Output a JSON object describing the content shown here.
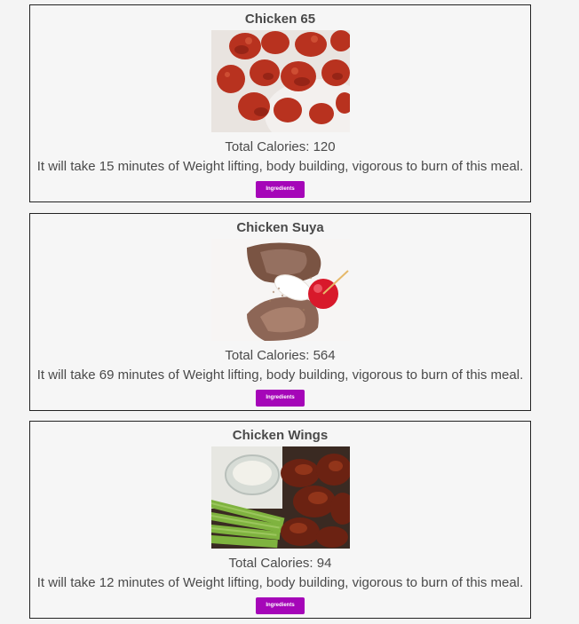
{
  "meals": [
    {
      "title": "Chicken 65",
      "calories_text": "Total Calories: 120",
      "burn_text": "It will take 15 minutes of Weight lifting, body building, vigorous to burn of this meal.",
      "button_label": "Ingredients",
      "image": "chicken-65-photo"
    },
    {
      "title": "Chicken Suya",
      "calories_text": "Total Calories: 564",
      "burn_text": "It will take 69 minutes of Weight lifting, body building, vigorous to burn of this meal.",
      "button_label": "Ingredients",
      "image": "chicken-suya-photo"
    },
    {
      "title": "Chicken Wings",
      "calories_text": "Total Calories: 94",
      "burn_text": "It will take 12 minutes of Weight lifting, body building, vigorous to burn of this meal.",
      "button_label": "Ingredients",
      "image": "chicken-wings-photo"
    }
  ],
  "colors": {
    "button": "#a506b8",
    "background": "#f4f4f4",
    "border": "#222222",
    "text": "#4a4a4a"
  }
}
